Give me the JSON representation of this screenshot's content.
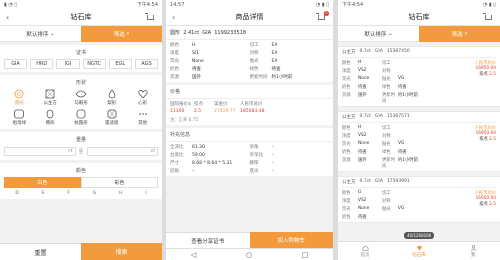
{
  "screens": {
    "filter": {
      "status_time": "下午4:54",
      "title": "钻石库",
      "sort_label": "默认排序",
      "filter_label": "筛选",
      "cert": {
        "title": "证书",
        "items": [
          "GIA",
          "HRD",
          "IGI",
          "NGTC",
          "EGL",
          "AGS"
        ]
      },
      "shape": {
        "title": "形状",
        "items": [
          "圆形",
          "公主方",
          "马眼形",
          "梨形",
          "心形",
          "祖母绿",
          "椭形",
          "枕圆形",
          "雷迪恩",
          "其他"
        ]
      },
      "weight": {
        "title": "重量",
        "unit1": "ct",
        "unit2": "ct",
        "separator": "至"
      },
      "color": {
        "title": "颜色",
        "tabs": [
          "白色",
          "彩色"
        ],
        "letters": [
          "D",
          "E",
          "F",
          "G",
          "H",
          "I"
        ]
      },
      "reset_label": "重置",
      "search_label": "搜索"
    },
    "detail": {
      "status_time": "14:57",
      "title": "商品详情",
      "cart_badge": "2",
      "header": {
        "shape": "圆形",
        "carat": "2.41ct",
        "cert": "GIA",
        "cert_no": "1199233518"
      },
      "specs": [
        [
          "颜色",
          "H",
          "切工",
          "EX"
        ],
        [
          "净度",
          "SI1",
          "对称",
          "EX"
        ],
        [
          "荧光",
          "None",
          "抛光",
          "EX"
        ],
        [
          "奶色",
          "待查",
          "绿色",
          "待查"
        ],
        [
          "货源",
          "国外",
          "更新时间",
          "约1小时前"
        ]
      ],
      "price_title": "价格",
      "price_headers": [
        "国际报价$",
        "扣点",
        "美金价",
        "人民币总价"
      ],
      "price_values": [
        "11100",
        "2.5",
        "27419.77",
        "185083.48"
      ],
      "rate_note": "注：汇率 6.75",
      "extra_title": "补充信息",
      "extra": [
        [
          "全深比",
          "61.30",
          "亭角",
          "–"
        ],
        [
          "台宽比",
          "59.00",
          "亭深比",
          "–"
        ],
        [
          "尺寸",
          "8.68 * 8.64 * 5.31",
          "腰厚",
          "–"
        ],
        [
          "冠角",
          "–",
          "底尖",
          "–"
        ],
        [
          "冠高",
          "–",
          "",
          ""
        ]
      ],
      "share_label": "查看分享证书",
      "addcart_label": "加入购物车"
    },
    "list": {
      "status_time": "下午4:54",
      "title": "钻石库",
      "sort_label": "默认排序",
      "filter_label": "筛选",
      "price_header": "人民币总价",
      "discount_label": "扣点",
      "cards": [
        {
          "shape": "公主方",
          "carat": "0.7ct",
          "cert": "GIA",
          "no": "15367450",
          "rows": [
            [
              "颜色",
              "H",
              "切工",
              ""
            ],
            [
              "净度",
              "VS2",
              "对称",
              ""
            ],
            [
              "荧光",
              "None",
              "抛光",
              "VG"
            ],
            [
              "奶色",
              "待查",
              "绿色",
              "待查"
            ],
            [
              "货源",
              "国外",
              "更新时间",
              "约1小时前"
            ]
          ],
          "price": "16950.94",
          "discount": "2.5"
        },
        {
          "shape": "公主方",
          "carat": "0.7ct",
          "cert": "GIA",
          "no": "15367571",
          "rows": [
            [
              "颜色",
              "H",
              "切工",
              ""
            ],
            [
              "净度",
              "VS2",
              "对称",
              ""
            ],
            [
              "荧光",
              "None",
              "抛光",
              "VG"
            ],
            [
              "奶色",
              "待查",
              "绿色",
              "待查"
            ],
            [
              "货源",
              "国外",
              "更新时间",
              "约1小时前"
            ]
          ],
          "price": "16950.94",
          "discount": "2.5"
        },
        {
          "shape": "公主方",
          "carat": "0.7ct",
          "cert": "GIA",
          "no": "17593991",
          "rows": [
            [
              "颜色",
              "G",
              "切工",
              ""
            ],
            [
              "净度",
              "VS2",
              "对称",
              ""
            ],
            [
              "荧光",
              "None",
              "抛光",
              "VG"
            ],
            [
              "奶色",
              "待查",
              "",
              ""
            ]
          ],
          "price": "16950.94",
          "discount": "2.5"
        }
      ],
      "toast": "40/1268166",
      "tabs": [
        "首页",
        "钻石库",
        "我"
      ]
    }
  }
}
